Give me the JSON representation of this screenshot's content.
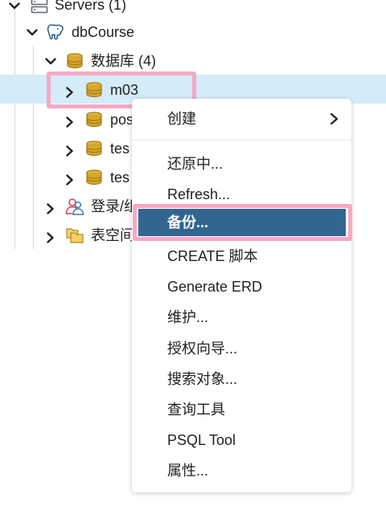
{
  "tree": {
    "servers_label": "Servers (1)",
    "server_label": "dbCourse",
    "databases_label": "数据库 (4)",
    "databases": [
      {
        "label": "m03"
      },
      {
        "label": "pos"
      },
      {
        "label": "tes"
      },
      {
        "label": "tes"
      }
    ],
    "login_roles_label": "登录/组",
    "tablespaces_label": "表空间"
  },
  "context_menu": {
    "items": [
      {
        "label": "创建"
      },
      {
        "label": "还原中..."
      },
      {
        "label": "Refresh..."
      },
      {
        "label": "备份..."
      },
      {
        "label": "CREATE 脚本"
      },
      {
        "label": "Generate ERD"
      },
      {
        "label": "维护..."
      },
      {
        "label": "授权向导..."
      },
      {
        "label": "搜索对象..."
      },
      {
        "label": "查询工具"
      },
      {
        "label": "PSQL Tool"
      },
      {
        "label": "属性..."
      }
    ]
  },
  "colors": {
    "selected_row": "#d4ebf9",
    "menu_active": "#326690",
    "highlight_box": "#f6a8c6",
    "database_icon": "#d6a72a",
    "elephant_icon": "#336791"
  },
  "icons": {
    "servers": "servers-icon",
    "server": "postgres-elephant-icon",
    "databases": "database-stack-icon",
    "database": "database-icon",
    "login_roles": "user-group-icon",
    "tablespaces": "folder-stack-icon",
    "submenu": "chevron-right-icon"
  }
}
